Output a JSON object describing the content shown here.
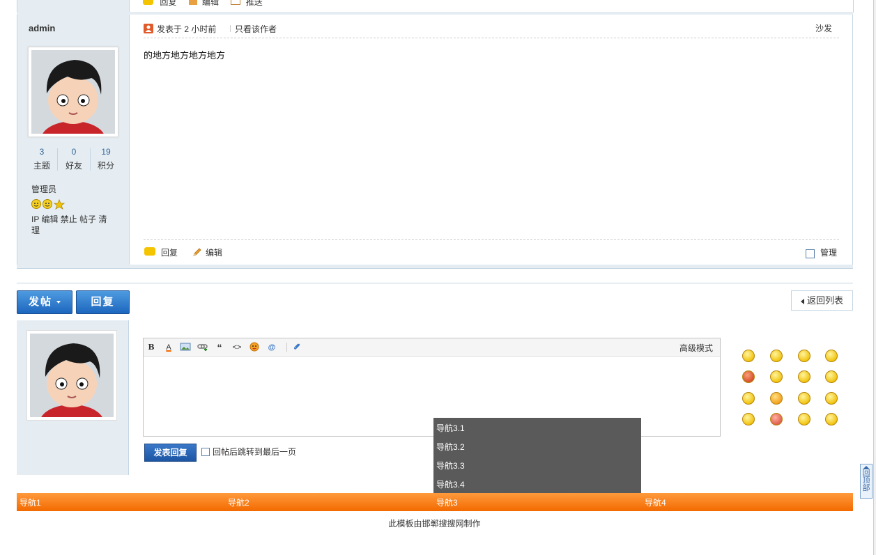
{
  "prev_post": {
    "reply": "回复",
    "edit": "编辑",
    "recommend": "推送"
  },
  "post": {
    "author": "admin",
    "stats": [
      {
        "num": "3",
        "label": "主题"
      },
      {
        "num": "0",
        "label": "好友"
      },
      {
        "num": "19",
        "label": "积分"
      }
    ],
    "role": "管理员",
    "admin_links": "IP 编辑 禁止 帖子 清理",
    "posted_at": "发表于 2 小时前",
    "only_author": "只看该作者",
    "floor": "沙发",
    "content": "的地方地方地方地方",
    "reply_label": "回复",
    "edit_label": "编辑",
    "manage_label": "管理"
  },
  "actions": {
    "new_post": "发帖",
    "reply": "回复",
    "back_to_list": "返回列表"
  },
  "editor": {
    "toolbar": [
      "B",
      "A",
      "image",
      "link",
      "“",
      "<>",
      "emoji",
      "@",
      "attach"
    ],
    "advanced_mode": "高级模式",
    "submit": "发表回复",
    "jump_last_page": "回帖后跳转到最后一页"
  },
  "dropdown": [
    "导航3.1",
    "导航3.2",
    "导航3.3",
    "导航3.4"
  ],
  "nav": [
    "导航1",
    "导航2",
    "导航3",
    "导航4"
  ],
  "footer": "此模板由邯郸搜搜网制作",
  "back_to_top": "回顶部",
  "colors": {
    "nav": "#f36a00",
    "side": "#e5edf2",
    "border": "#c2d5e3",
    "button": "#1d66be"
  }
}
